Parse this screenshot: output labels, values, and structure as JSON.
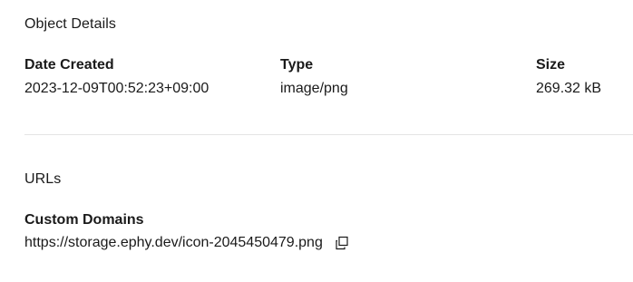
{
  "object_details": {
    "title": "Object Details",
    "date_created": {
      "label": "Date Created",
      "value": "2023-12-09T00:52:23+09:00"
    },
    "type": {
      "label": "Type",
      "value": "image/png"
    },
    "size": {
      "label": "Size",
      "value": "269.32 kB"
    }
  },
  "urls": {
    "title": "URLs",
    "custom_domains": {
      "label": "Custom Domains",
      "url": "https://storage.ephy.dev/icon-2045450479.png",
      "copy_icon": "copy-icon"
    }
  },
  "colors": {
    "text": "#1a1a1a",
    "divider": "#e4e4e4",
    "background": "#ffffff"
  }
}
